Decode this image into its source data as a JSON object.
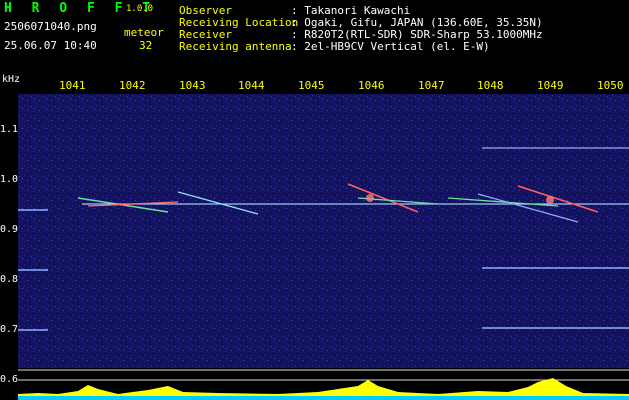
{
  "app": {
    "logo": "H R O F F T",
    "version": "1.0.0"
  },
  "file": {
    "name": "2506071040.png",
    "datetime": "25.06.07 10:40",
    "type_label": "meteor",
    "count": "32"
  },
  "info": {
    "observer_label": "Observer",
    "observer_value": ": Takanori Kawachi",
    "location_label": "Receiving Location",
    "location_value": ": Ogaki, Gifu, JAPAN (136.60E, 35.35N)",
    "receiver_label": "Receiver",
    "receiver_value": ": R820T2(RTL-SDR) SDR-Sharp 53.1000MHz",
    "antenna_label": "Receiving antenna",
    "antenna_value": ": 2el-HB9CV Vertical (el. E-W)"
  },
  "axis": {
    "unit": "kHz",
    "time_ticks": [
      "1041",
      "1042",
      "1043",
      "1044",
      "1045",
      "1046",
      "1047",
      "1048",
      "1049",
      "1050"
    ],
    "freq_ticks": [
      "1.1",
      "1.0",
      "0.9",
      "0.8",
      "0.7",
      "0.6"
    ]
  },
  "colors": {
    "background": "#000000",
    "text_main": "#ffffff",
    "text_accent": "#ffff00",
    "logo": "#00ff00",
    "noise": "#1a1a80",
    "level_bar": "#ffff00",
    "baseline": "#00ccff"
  }
}
